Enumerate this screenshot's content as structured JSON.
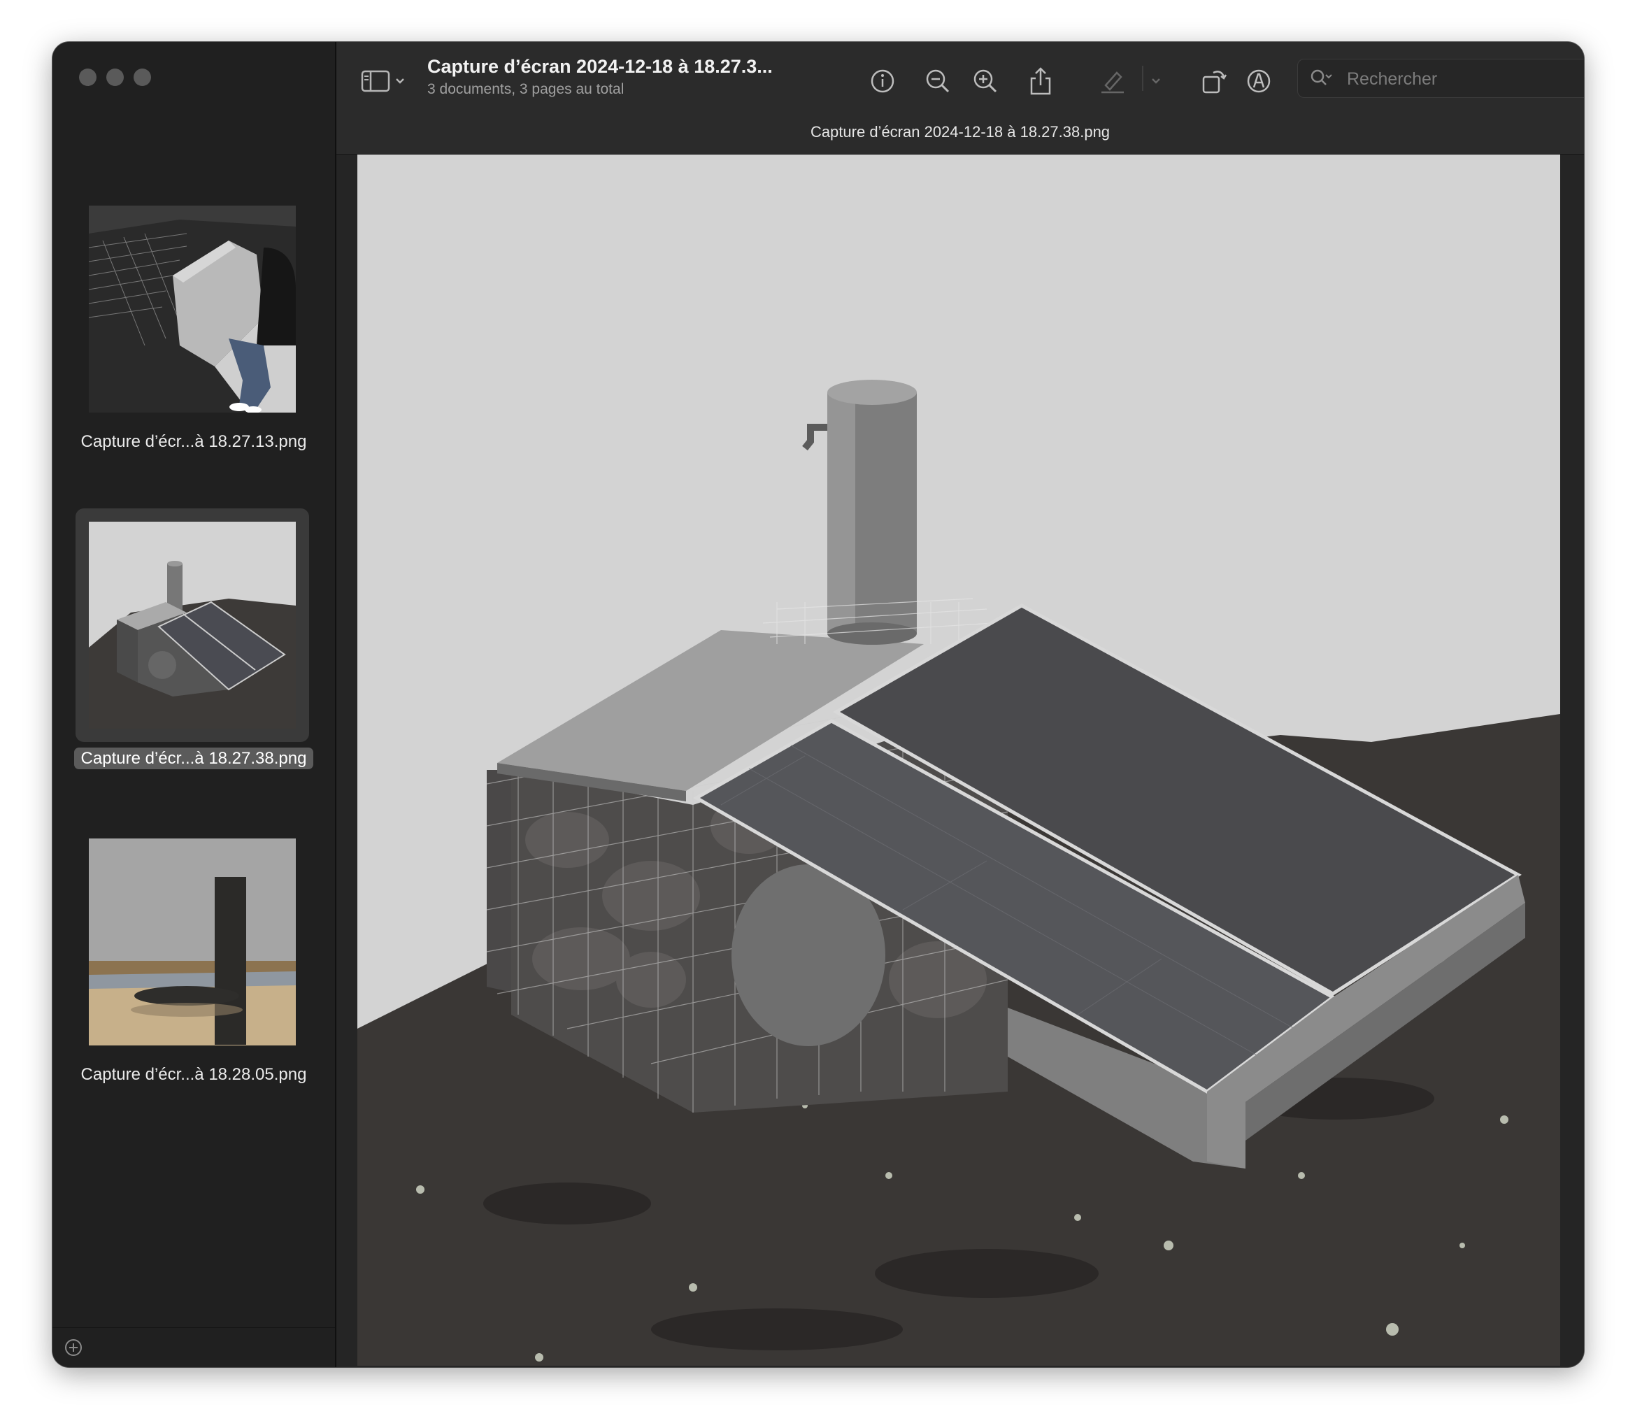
{
  "window": {
    "title": "Capture d’écran 2024-12-18 à 18.27.3...",
    "subtitle": "3 documents, 3 pages au total",
    "document_name": "Capture d’écran 2024-12-18 à 18.27.38.png"
  },
  "search": {
    "placeholder": "Rechercher"
  },
  "toolbar": {
    "icons": [
      "sidebar-toggle-icon",
      "chevron-down-icon",
      "info-icon",
      "zoom-out-icon",
      "zoom-in-icon",
      "share-icon",
      "highlight-pen-icon",
      "chevron-down-icon",
      "rotate-icon",
      "markup-icon"
    ]
  },
  "sidebar": {
    "items": [
      {
        "label": "Capture d’écr...à 18.27.13.png",
        "selected": false
      },
      {
        "label": "Capture d’écr...à 18.27.38.png",
        "selected": true
      },
      {
        "label": "Capture d’écr...à 18.28.05.png",
        "selected": false
      }
    ]
  },
  "colors": {
    "window_bg": "#252525",
    "sidebar_bg": "#202020",
    "titlebar_bg": "#2b2b2b",
    "image_bg": "#d3d3d3"
  }
}
